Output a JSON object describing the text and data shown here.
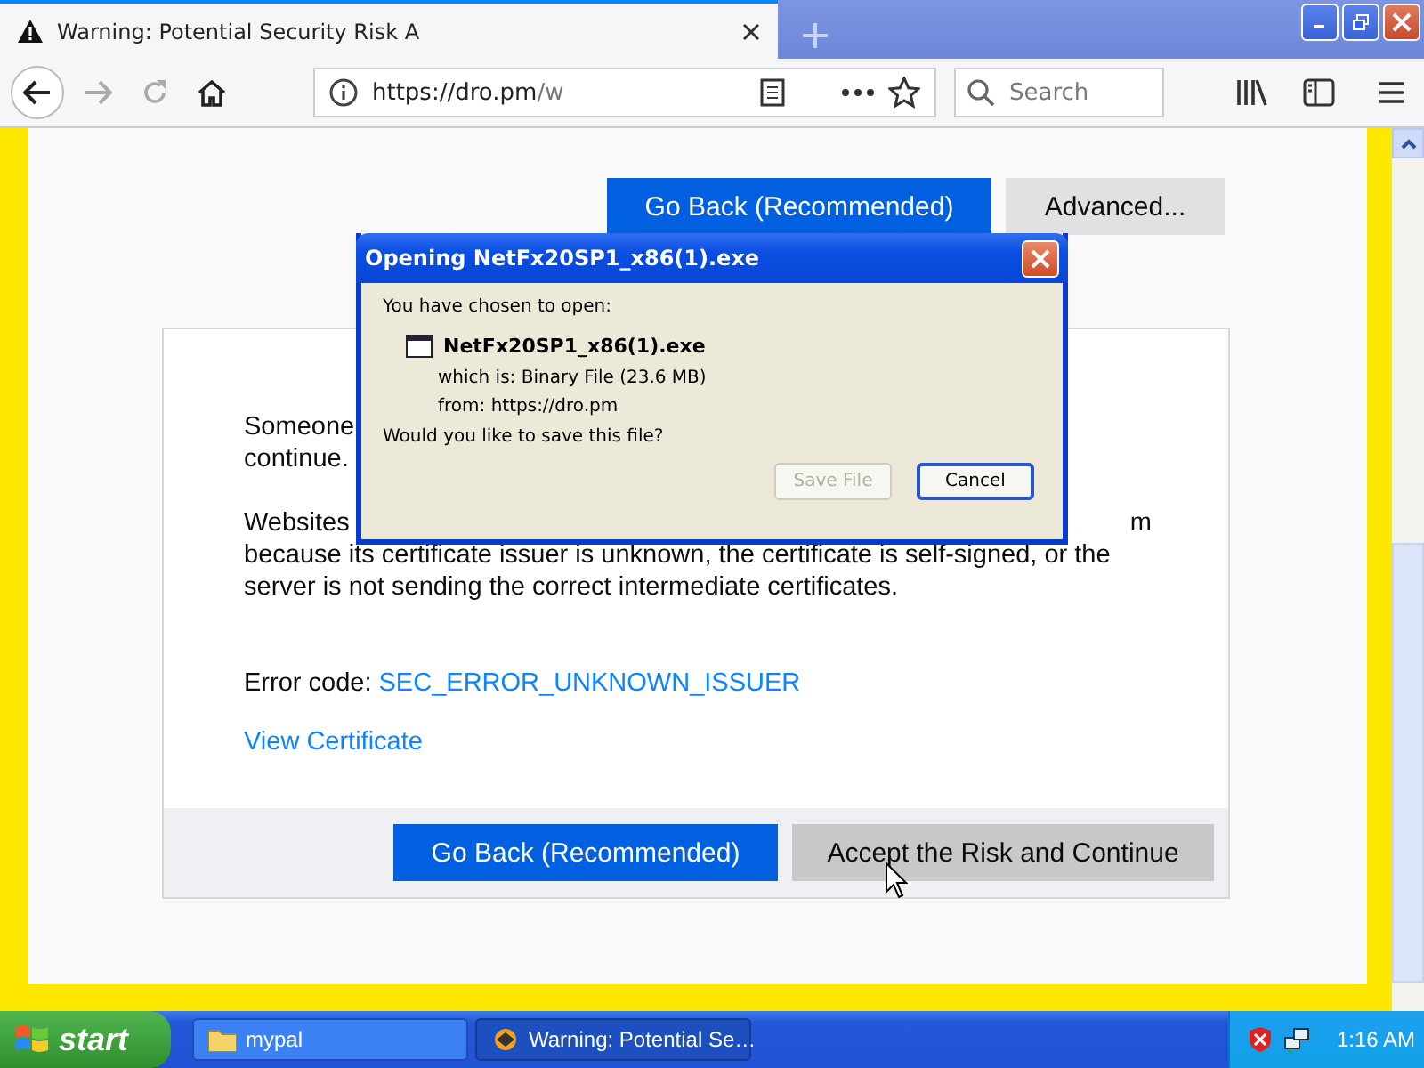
{
  "tabs": [
    {
      "label": "Warning: Potential Security Risk A",
      "selected": true
    }
  ],
  "toolbar": {
    "url_host": "https://dro.pm",
    "url_path": "/w",
    "search": {
      "placeholder": "Search"
    }
  },
  "page": {
    "top_buttons": [
      {
        "label": "Go Back (Recommended)",
        "kind": "primary"
      },
      {
        "label": "Advanced...",
        "kind": "secondary"
      }
    ],
    "paragraphs": [
      {
        "lines": [
          {
            "text": "Someone"
          },
          {
            "text": "continue."
          }
        ]
      },
      {
        "lines": [
          {
            "text": "Websites",
            "tail": "m"
          },
          {
            "text": "because its certificate issuer is unknown, the certificate is self-signed, or the"
          },
          {
            "text": "server is not sending the correct intermediate certificates."
          }
        ]
      }
    ],
    "error": {
      "label": "Error code:",
      "code": "SEC_ERROR_UNKNOWN_ISSUER"
    },
    "link": "View Certificate",
    "footer_buttons": [
      {
        "label": "Go Back (Recommended)",
        "kind": "primary"
      },
      {
        "label": "Accept the Risk and Continue",
        "kind": "secondary"
      }
    ]
  },
  "dialog": {
    "title": "Opening NetFx20SP1_x86(1).exe",
    "intro": "You have chosen to open:",
    "file_name": "NetFx20SP1_x86(1).exe",
    "type_label": "which is:",
    "type": "Binary File (23.6 MB)",
    "from_label": "from:",
    "from": "https://dro.pm",
    "question": "Would you like to save this file?",
    "buttons": [
      {
        "label": "Save File",
        "disabled": true,
        "default": false
      },
      {
        "label": "Cancel",
        "disabled": false,
        "default": true
      }
    ]
  },
  "taskbar": {
    "start": "start",
    "items": [
      {
        "label": "mypal",
        "kind": "folder",
        "selected": false
      },
      {
        "label": "Warning: Potential Se…",
        "kind": "browser",
        "selected": true
      }
    ],
    "clock": "1:16 AM"
  }
}
